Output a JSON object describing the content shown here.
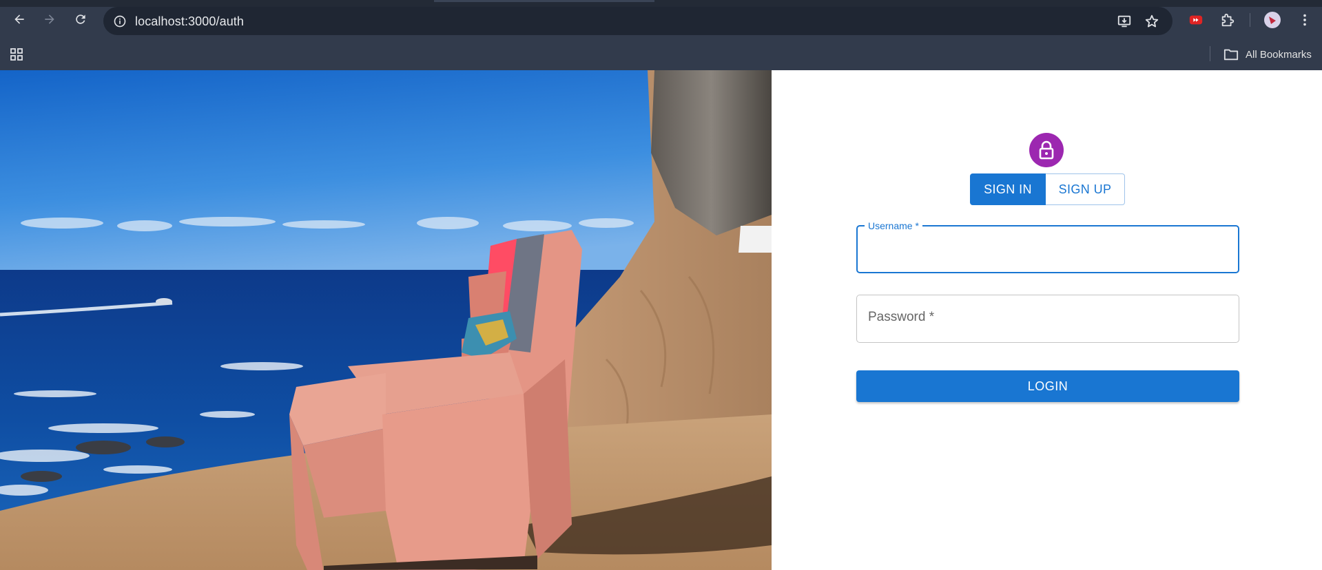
{
  "browser": {
    "url": "localhost:3000/auth",
    "bookmarks_all": "All Bookmarks",
    "icons": {
      "back": "back-arrow-icon",
      "forward": "forward-arrow-icon",
      "reload": "reload-icon",
      "site_info": "site-info-icon",
      "install": "install-app-icon",
      "bookmark_star": "star-icon",
      "extension_red": "extension-icon",
      "extensions": "puzzle-icon",
      "profile": "profile-avatar",
      "menu": "kebab-menu-icon",
      "apps": "apps-grid-icon",
      "folder": "folder-icon"
    }
  },
  "auth": {
    "lock_icon": "lock-icon",
    "tabs": {
      "sign_in": "SIGN IN",
      "sign_up": "SIGN UP",
      "active": "sign_in"
    },
    "username_label": "Username *",
    "username_value": "",
    "password_label": "Password *",
    "password_value": "",
    "login_label": "LOGIN"
  },
  "colors": {
    "primary": "#1976d2",
    "avatar": "#9c27b0",
    "chrome_bg": "#323b4c",
    "omnibox_bg": "#1f2633"
  }
}
